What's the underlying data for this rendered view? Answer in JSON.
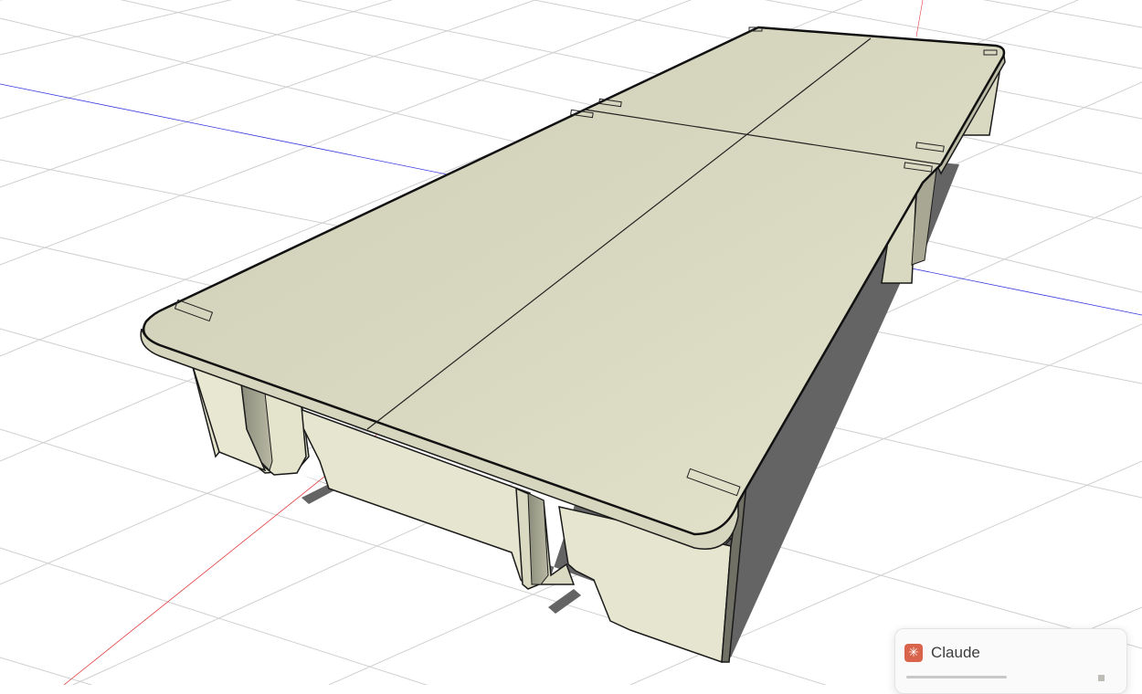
{
  "assistant_panel": {
    "title": "Claude",
    "icon": "claude-logo-icon",
    "accent_color": "#d9644b"
  },
  "scene": {
    "description_icon": "3d-model-viewport",
    "axis_colors": {
      "red": "#e03a3a",
      "blue": "#3a3ae0"
    },
    "material_color": "#dcdcc4"
  }
}
